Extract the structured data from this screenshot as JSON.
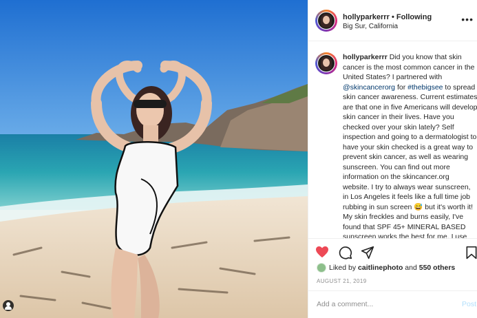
{
  "post": {
    "username": "hollyparkerrr",
    "follow_separator": "•",
    "follow_status": "Following",
    "location": "Big Sur, California",
    "more_icon": "more-options-icon",
    "caption": {
      "username": "hollyparkerrr",
      "text_1": " Did you know that skin cancer is the most common cancer in the United States? I partnered with ",
      "mention": "@skincancerorg",
      "text_2": " for ",
      "hashtag": "#thebigsee",
      "text_3": " to spread skin cancer awareness. Current estimates are that one in five Americans will develop skin cancer in their lives. Have you checked over your skin lately? Self inspection and going to a dermatologist to have your skin checked is a great way to prevent skin cancer, as well as wearing sunscreen. You can find out more information on the skincancer.org website. I try to always wear sunscreen, in Los Angeles it feels like a full time job rubbing in sun screen 😅  but it's worth it! My skin freckles and burns easily, I've found that SPF 45+ MINERAL BASED sunscreen works the best for me, I use Coffee berry by Alba and Bambu...",
      "emoji": "😅"
    },
    "liked": {
      "prefix": "Liked by ",
      "user": "caitlinephoto",
      "middle": " and ",
      "count": "550 others"
    },
    "date": "AUGUST 21, 2019",
    "comment_placeholder": "Add a comment...",
    "post_label": "Post",
    "colors": {
      "like": "#ed4956",
      "link": "#00376b",
      "muted": "#8e8e8e",
      "post_disabled": "#b2dffc"
    },
    "icons": [
      "heart-icon",
      "comment-icon",
      "share-icon",
      "bookmark-icon",
      "user-tag-icon"
    ]
  }
}
